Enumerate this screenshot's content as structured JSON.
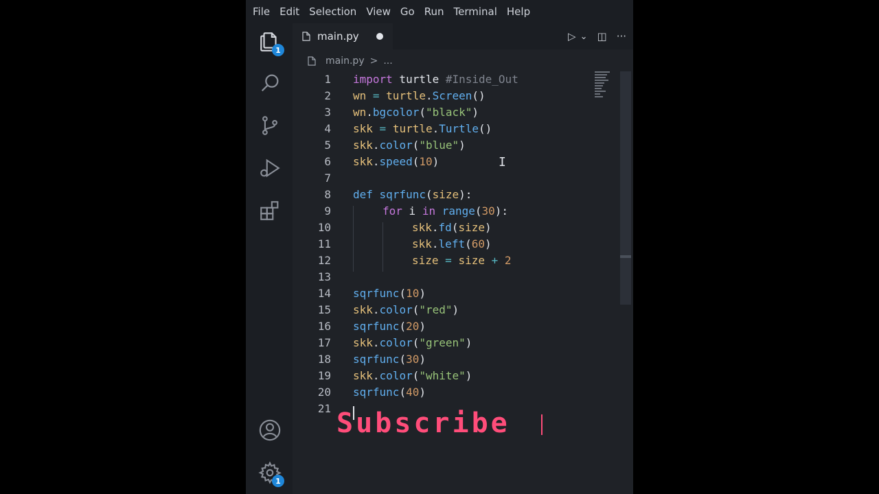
{
  "menu": [
    "File",
    "Edit",
    "Selection",
    "View",
    "Go",
    "Run",
    "Terminal",
    "Help"
  ],
  "activity": {
    "explorer_badge": "1",
    "settings_badge": "1"
  },
  "tab": {
    "label": "main.py"
  },
  "tab_actions": {
    "run_icon": "▷",
    "chevron": "⌄",
    "split_icon": "◫",
    "more": "···"
  },
  "breadcrumbs": {
    "file": "main.py",
    "separator": ">",
    "more": "..."
  },
  "code_lines": [
    {
      "no": "1"
    },
    {
      "no": "2"
    },
    {
      "no": "3"
    },
    {
      "no": "4"
    },
    {
      "no": "5"
    },
    {
      "no": "6"
    },
    {
      "no": "7"
    },
    {
      "no": "8"
    },
    {
      "no": "9"
    },
    {
      "no": "10"
    },
    {
      "no": "11"
    },
    {
      "no": "12"
    },
    {
      "no": "13"
    },
    {
      "no": "14"
    },
    {
      "no": "15"
    },
    {
      "no": "16"
    },
    {
      "no": "17"
    },
    {
      "no": "18"
    },
    {
      "no": "19"
    },
    {
      "no": "20"
    },
    {
      "no": "21"
    }
  ],
  "code": {
    "l1a": "import",
    "l1b": " turtle ",
    "l1c": "#Inside_Out",
    "l2a": "wn",
    "l2b": " = ",
    "l2c": "turtle",
    "l2d": ".",
    "l2e": "Screen",
    "l2f": "()",
    "l3a": "wn",
    "l3b": ".",
    "l3c": "bgcolor",
    "l3d": "(",
    "l3e": "\"black\"",
    "l3f": ")",
    "l4a": "skk",
    "l4b": " = ",
    "l4c": "turtle",
    "l4d": ".",
    "l4e": "Turtle",
    "l4f": "()",
    "l5a": "skk",
    "l5b": ".",
    "l5c": "color",
    "l5d": "(",
    "l5e": "\"blue\"",
    "l5f": ")",
    "l6a": "skk",
    "l6b": ".",
    "l6c": "speed",
    "l6d": "(",
    "l6e": "10",
    "l6f": ")",
    "l8a": "def",
    "l8b": " ",
    "l8c": "sqrfunc",
    "l8d": "(",
    "l8e": "size",
    "l8f": "):",
    "l9a": "for",
    "l9b": " i ",
    "l9c": "in",
    "l9d": " ",
    "l9e": "range",
    "l9f": "(",
    "l9g": "30",
    "l9h": "):",
    "l10a": "skk",
    "l10b": ".",
    "l10c": "fd",
    "l10d": "(",
    "l10e": "size",
    "l10f": ")",
    "l11a": "skk",
    "l11b": ".",
    "l11c": "left",
    "l11d": "(",
    "l11e": "60",
    "l11f": ")",
    "l12a": "size",
    "l12b": " = ",
    "l12c": "size",
    "l12d": " + ",
    "l12e": "2",
    "l14a": "sqrfunc",
    "l14b": "(",
    "l14c": "10",
    "l14d": ")",
    "l15a": "skk",
    "l15b": ".",
    "l15c": "color",
    "l15d": "(",
    "l15e": "\"red\"",
    "l15f": ")",
    "l16a": "sqrfunc",
    "l16b": "(",
    "l16c": "20",
    "l16d": ")",
    "l17a": "skk",
    "l17b": ".",
    "l17c": "color",
    "l17d": "(",
    "l17e": "\"green\"",
    "l17f": ")",
    "l18a": "sqrfunc",
    "l18b": "(",
    "l18c": "30",
    "l18d": ")",
    "l19a": "skk",
    "l19b": ".",
    "l19c": "color",
    "l19d": "(",
    "l19e": "\"white\"",
    "l19f": ")",
    "l20a": "sqrfunc",
    "l20b": "(",
    "l20c": "40",
    "l20d": ")"
  },
  "overlay": {
    "subscribe": "Subscribe"
  },
  "colors": {
    "accent": "#1f87d9",
    "subscribe": "#ff4d7a",
    "editor_bg": "#1f2227"
  }
}
